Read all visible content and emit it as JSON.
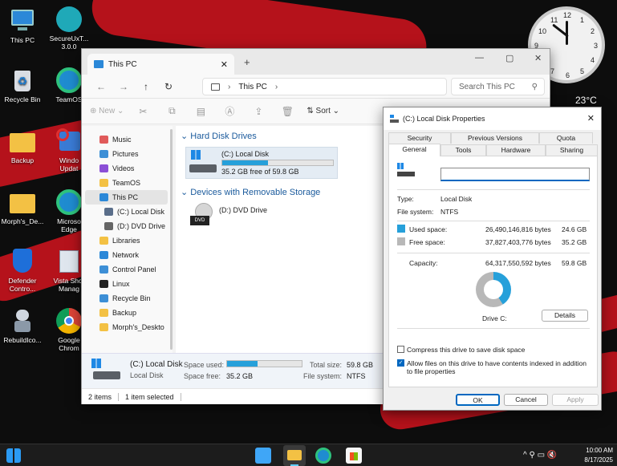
{
  "desktop": {
    "icons": [
      {
        "label": "This PC"
      },
      {
        "label": "SecureUxT...\n3.0.0"
      },
      {
        "label": "Recycle Bin"
      },
      {
        "label": "TeamOS"
      },
      {
        "label": "Backup"
      },
      {
        "label": "Windo\nUpdat"
      },
      {
        "label": "Morph's_De..."
      },
      {
        "label": "Microso\nEdge"
      },
      {
        "label": "Defender\nContro..."
      },
      {
        "label": "Vista Shor\nManag"
      },
      {
        "label": "RebuildIco..."
      },
      {
        "label": "Google\nChrom"
      }
    ],
    "clock_numbers": [
      "12",
      "1",
      "2",
      "3",
      "4",
      "5",
      "6",
      "7",
      "8",
      "9",
      "10",
      "11"
    ],
    "temperature": "23°C"
  },
  "explorer": {
    "tab_title": "This PC",
    "address": "This PC",
    "search_placeholder": "Search This PC",
    "toolbar": {
      "new": "New",
      "sort": "Sort"
    },
    "sidebar": [
      {
        "label": "Music",
        "color": "#e05a5a"
      },
      {
        "label": "Pictures",
        "color": "#3d8fd6"
      },
      {
        "label": "Videos",
        "color": "#8b4fd6"
      },
      {
        "label": "TeamOS",
        "color": "#f3c144"
      },
      {
        "label": "This PC",
        "color": "#2b88d8"
      },
      {
        "label": "(C:) Local Disk",
        "color": "#5a6e8a"
      },
      {
        "label": "(D:) DVD Drive",
        "color": "#666666"
      },
      {
        "label": "Libraries",
        "color": "#f3c144"
      },
      {
        "label": "Network",
        "color": "#2b88d8"
      },
      {
        "label": "Control Panel",
        "color": "#3d8fd6"
      },
      {
        "label": "Linux",
        "color": "#222222"
      },
      {
        "label": "Recycle Bin",
        "color": "#3d8fd6"
      },
      {
        "label": "Backup",
        "color": "#f3c144"
      },
      {
        "label": "Morph's_Deskto",
        "color": "#f3c144"
      }
    ],
    "groups": {
      "hdd": "Hard Disk Drives",
      "removable": "Devices with Removable Storage"
    },
    "drives": {
      "c": {
        "name": "(C:) Local Disk",
        "free": "35.2 GB free of 59.8 GB",
        "used_fraction": 0.41
      },
      "d": {
        "name": "(D:) DVD Drive",
        "badge": "DVD"
      }
    },
    "details": {
      "name": "(C:) Local Disk",
      "type": "Local Disk",
      "space_used_label": "Space used:",
      "space_free_label": "Space free:",
      "space_free": "35.2 GB",
      "total_size_label": "Total size:",
      "total_size": "59.8 GB",
      "fs_label": "File system:",
      "fs": "NTFS"
    },
    "status": {
      "items": "2 items",
      "selected": "1 item selected"
    }
  },
  "dialog": {
    "title": "(C:) Local Disk Properties",
    "tabs_top": [
      "Security",
      "Previous Versions",
      "Quota"
    ],
    "tabs_bottom": [
      "General",
      "Tools",
      "Hardware",
      "Sharing"
    ],
    "name_value": "",
    "type_label": "Type:",
    "type_value": "Local Disk",
    "fs_label": "File system:",
    "fs_value": "NTFS",
    "used_label": "Used space:",
    "used_bytes": "26,490,146,816 bytes",
    "used_gb": "24.6 GB",
    "free_label": "Free space:",
    "free_bytes": "37,827,403,776 bytes",
    "free_gb": "35.2 GB",
    "capacity_label": "Capacity:",
    "capacity_bytes": "64,317,550,592 bytes",
    "capacity_gb": "59.8 GB",
    "used_fraction": 0.41,
    "drive_label": "Drive C:",
    "details_btn": "Details",
    "compress": "Compress this drive to save disk space",
    "index": "Allow files on this drive to have contents indexed in addition to file properties",
    "ok": "OK",
    "cancel": "Cancel",
    "apply": "Apply",
    "colors": {
      "used": "#26a0da",
      "free": "#b8b8b8"
    }
  },
  "taskbar": {
    "time": "10:00 AM",
    "date": "8/17/2025"
  }
}
